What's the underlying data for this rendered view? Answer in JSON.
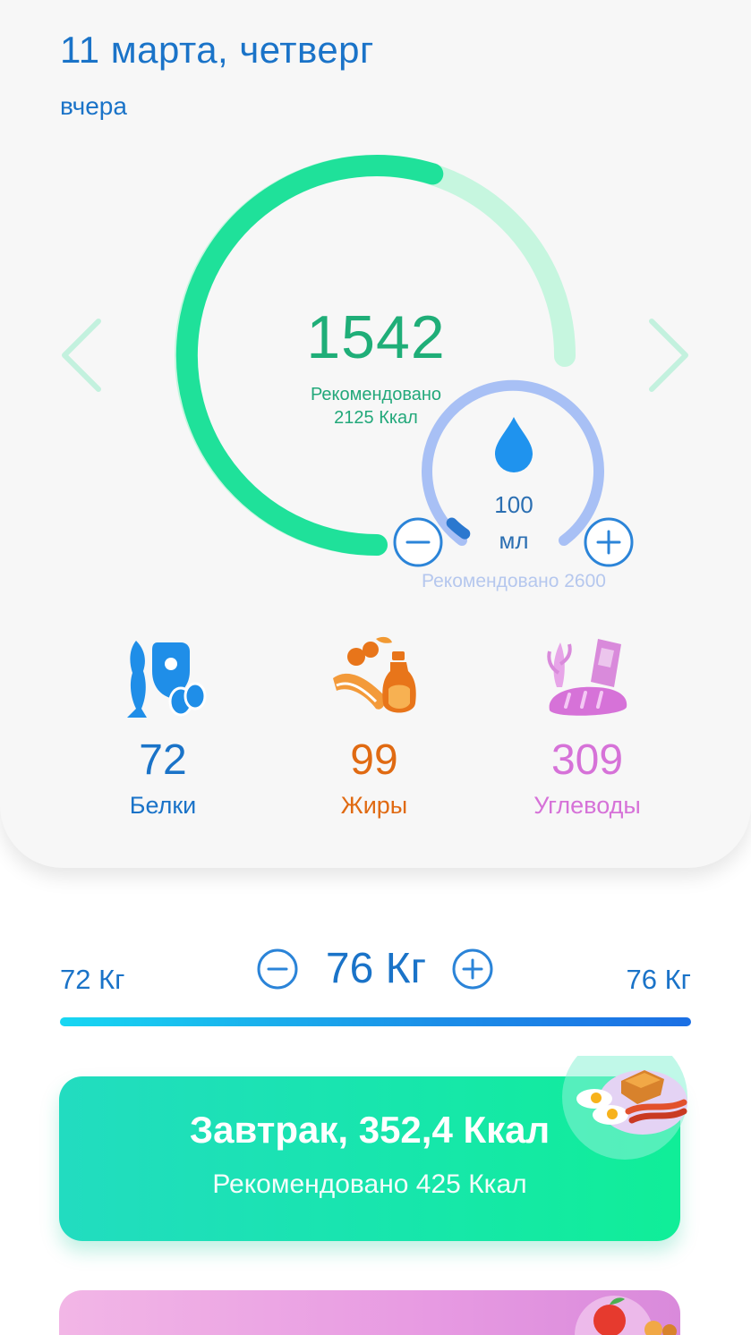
{
  "header": {
    "date": "11 марта, четверг",
    "relative_day": "вчера"
  },
  "calories": {
    "value": "1542",
    "recommended_line1": "Рекомендовано",
    "recommended_line2": "2125 Ккал",
    "progress_fraction": 0.73
  },
  "water": {
    "amount": "100",
    "unit": "мл",
    "recommended": "Рекомендовано 2600",
    "progress_fraction": 0.04
  },
  "macros": [
    {
      "value": "72",
      "label": "Белки",
      "icon": "protein-icon",
      "color": "#1a73c8"
    },
    {
      "value": "99",
      "label": "Жиры",
      "icon": "fat-icon",
      "color": "#e06a12"
    },
    {
      "value": "309",
      "label": "Углеводы",
      "icon": "carbs-icon",
      "color": "#d672d8"
    }
  ],
  "weight": {
    "min": "72 Кг",
    "current": "76 Кг",
    "max": "76 Кг"
  },
  "meal": {
    "title": "Завтрак, 352,4 Ккал",
    "recommended": "Рекомендовано 425 Ккал",
    "icon": "breakfast-plate-icon"
  },
  "colors": {
    "accent_blue": "#1a73c8",
    "calorie_green": "#1fe19a",
    "calorie_track": "#c6f6df",
    "water_blue": "#9fb9f4",
    "fat_orange": "#e06a12",
    "carbs_pink": "#d672d8"
  }
}
